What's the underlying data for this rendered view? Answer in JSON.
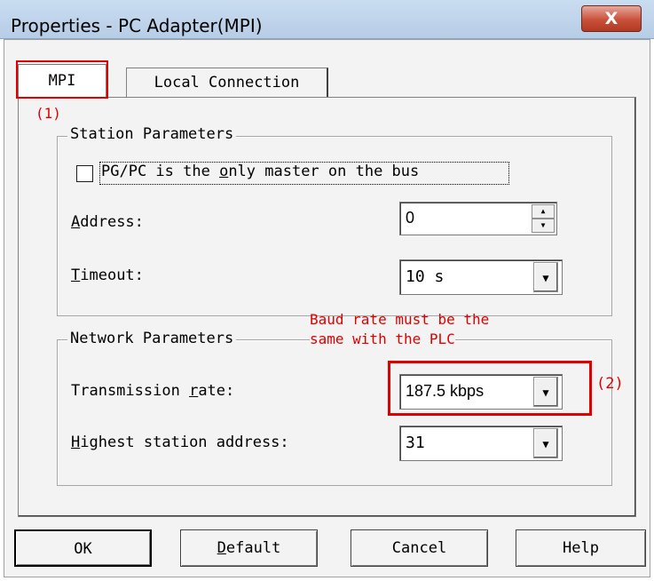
{
  "window": {
    "title": "Properties - PC Adapter(MPI)",
    "close_glyph": "X"
  },
  "tabs": [
    {
      "label": "MPI",
      "active": true
    },
    {
      "label": "Local Connection",
      "active": false
    }
  ],
  "annotations": {
    "marker1": "(1)",
    "marker2": "(2)",
    "note_line1": "Baud rate must be the",
    "note_line2": "same with the PLC",
    "color": "#e00000"
  },
  "station_parameters": {
    "group_label": "Station Parameters",
    "checkbox": {
      "label_pre": "PG/PC is the ",
      "label_key": "o",
      "label_post": "nly master on the bus",
      "checked": false
    },
    "address": {
      "label_key": "A",
      "label_rest": "ddress:",
      "value": "0"
    },
    "timeout": {
      "label_key": "T",
      "label_rest": "imeout:",
      "value": "10 s"
    }
  },
  "network_parameters": {
    "group_label": "Network Parameters",
    "transmission_rate": {
      "label_pre": "Transmission ",
      "label_key": "r",
      "label_post": "ate:",
      "value": "187.5 kbps"
    },
    "highest_station": {
      "label_key": "H",
      "label_rest": "ighest station address:",
      "value": "31"
    }
  },
  "buttons": {
    "ok": "OK",
    "default_key": "D",
    "default_rest": "efault",
    "cancel": "Cancel",
    "help": "Help"
  },
  "icons": {
    "close": "close-icon",
    "dropdown": "chevron-down-icon",
    "spin_up": "spin-up-icon",
    "spin_down": "spin-down-icon"
  }
}
